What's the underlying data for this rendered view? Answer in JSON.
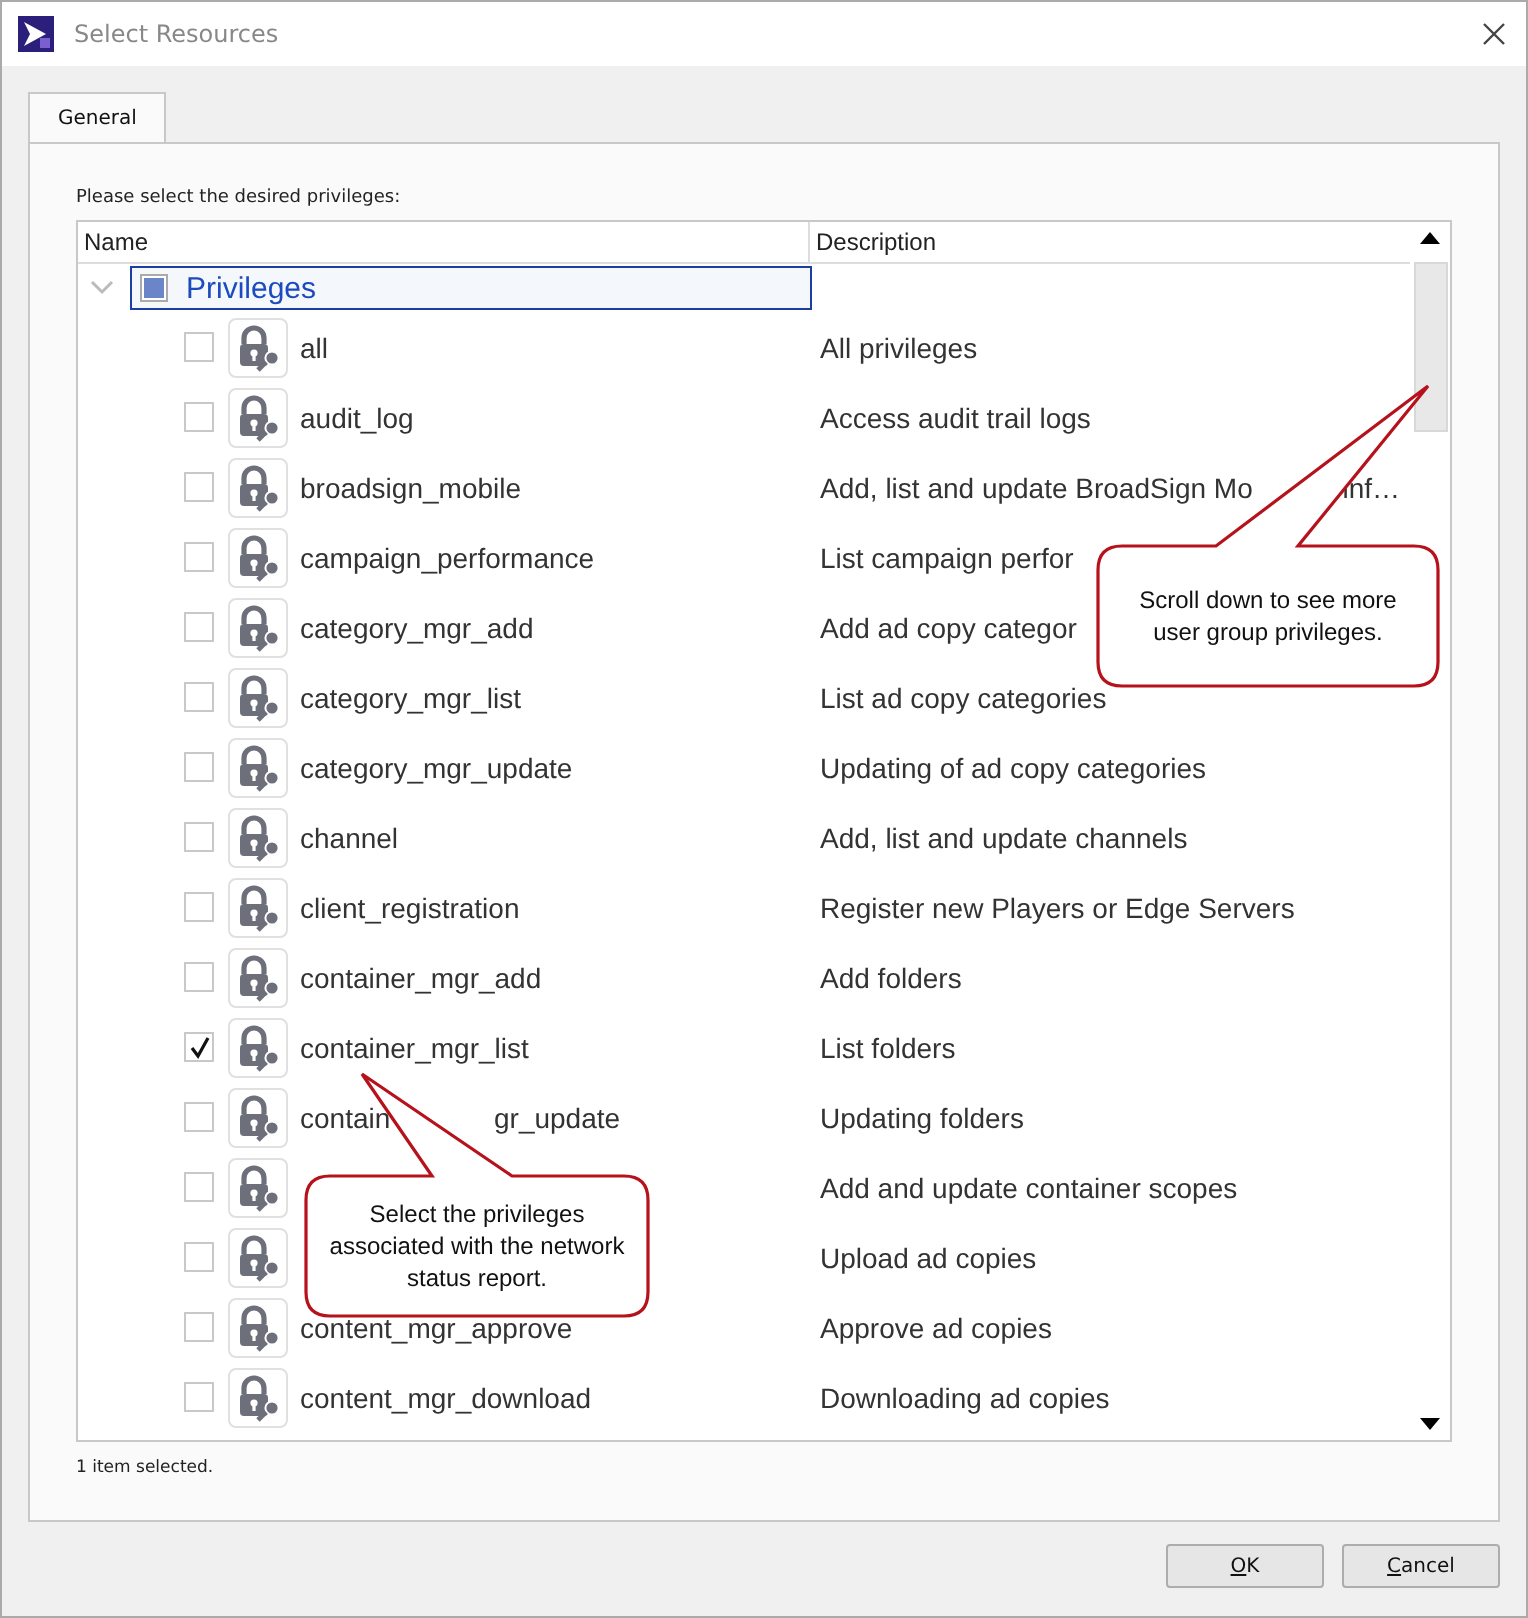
{
  "window": {
    "title": "Select Resources"
  },
  "tabs": [
    {
      "label": "General",
      "selected": true
    }
  ],
  "prompt": "Please select the desired privileges:",
  "table": {
    "columns": [
      "Name",
      "Description"
    ],
    "root": {
      "label": "Privileges",
      "expanded": true,
      "selected": true,
      "partial": true,
      "children": [
        {
          "name": "all",
          "description": "All privileges",
          "checked": false
        },
        {
          "name": "audit_log",
          "description": "Access audit trail logs",
          "checked": false
        },
        {
          "name": "broadsign_mobile",
          "description": "Add, list and update BroadSign Mo",
          "description_tail": "inf…",
          "checked": false
        },
        {
          "name": "campaign_performance",
          "description": "List campaign perfor",
          "checked": false
        },
        {
          "name": "category_mgr_add",
          "description": "Add ad copy categor",
          "checked": false
        },
        {
          "name": "category_mgr_list",
          "description": "List ad copy categories",
          "checked": false
        },
        {
          "name": "category_mgr_update",
          "description": "Updating of ad copy categories",
          "checked": false
        },
        {
          "name": "channel",
          "description": "Add, list and update channels",
          "checked": false
        },
        {
          "name": "client_registration",
          "description": "Register new Players or Edge Servers",
          "checked": false
        },
        {
          "name": "container_mgr_add",
          "description": "Add folders",
          "checked": false
        },
        {
          "name": "container_mgr_list",
          "description": "List folders",
          "checked": true
        },
        {
          "name": "contain",
          "name_tail": "gr_update",
          "description": "Updating folders",
          "checked": false
        },
        {
          "description": "Add and update container scopes",
          "checked": false
        },
        {
          "description": "Upload ad copies",
          "checked": false
        },
        {
          "name": "content_mgr_approve",
          "description": "Approve ad copies",
          "checked": false
        },
        {
          "name": "content_mgr_download",
          "description": "Downloading ad copies",
          "checked": false
        }
      ]
    }
  },
  "status": "1 item selected.",
  "callouts": [
    {
      "text": "Scroll down to see more user group privileges."
    },
    {
      "text": "Select the privileges associated with the network status report."
    }
  ],
  "buttons": [
    {
      "label": "OK"
    },
    {
      "label": "Cancel"
    }
  ]
}
